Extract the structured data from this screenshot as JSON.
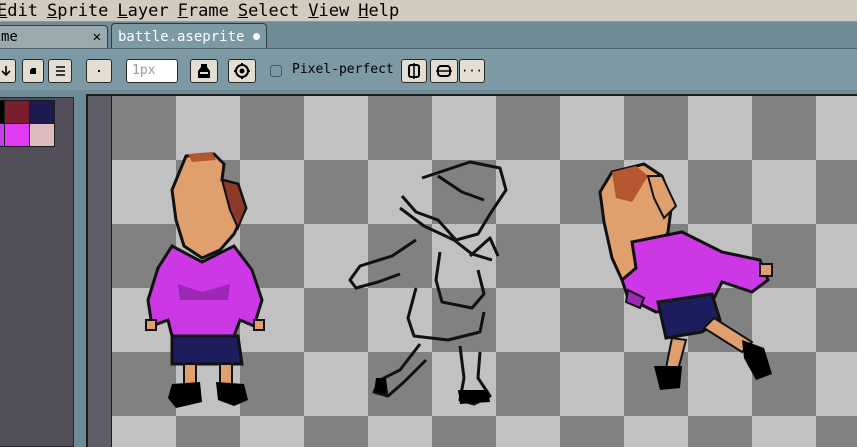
{
  "menu": {
    "items": [
      {
        "ul": "E",
        "rest": "dit"
      },
      {
        "ul": "S",
        "rest": "prite"
      },
      {
        "ul": "L",
        "rest": "ayer"
      },
      {
        "ul": "F",
        "rest": "rame"
      },
      {
        "ul": "S",
        "rest": "elect"
      },
      {
        "ul": "V",
        "rest": "iew"
      },
      {
        "ul": "H",
        "rest": "elp"
      }
    ]
  },
  "tabs": {
    "inactive_label": "me",
    "inactive_close": "✕",
    "active_label": "battle.aseprite"
  },
  "toolbar": {
    "brush_size_placeholder": "1px",
    "pixel_perfect_label": "Pixel-perfect",
    "more_label": "···"
  },
  "palette": {
    "colors": [
      "#000000",
      "#7a1d2c",
      "#1c1a4e",
      "#c33fe8",
      "#e23bf4",
      "#dcbcbc"
    ]
  },
  "colors": {
    "menubar": "#d3cbbd",
    "toolbar": "#7d99a3",
    "checker_dark": "#818181",
    "checker_light": "#c1c1c1",
    "hair": "#e0a06e",
    "shirt": "#cc38e6",
    "skirt": "#1d1e5e"
  }
}
